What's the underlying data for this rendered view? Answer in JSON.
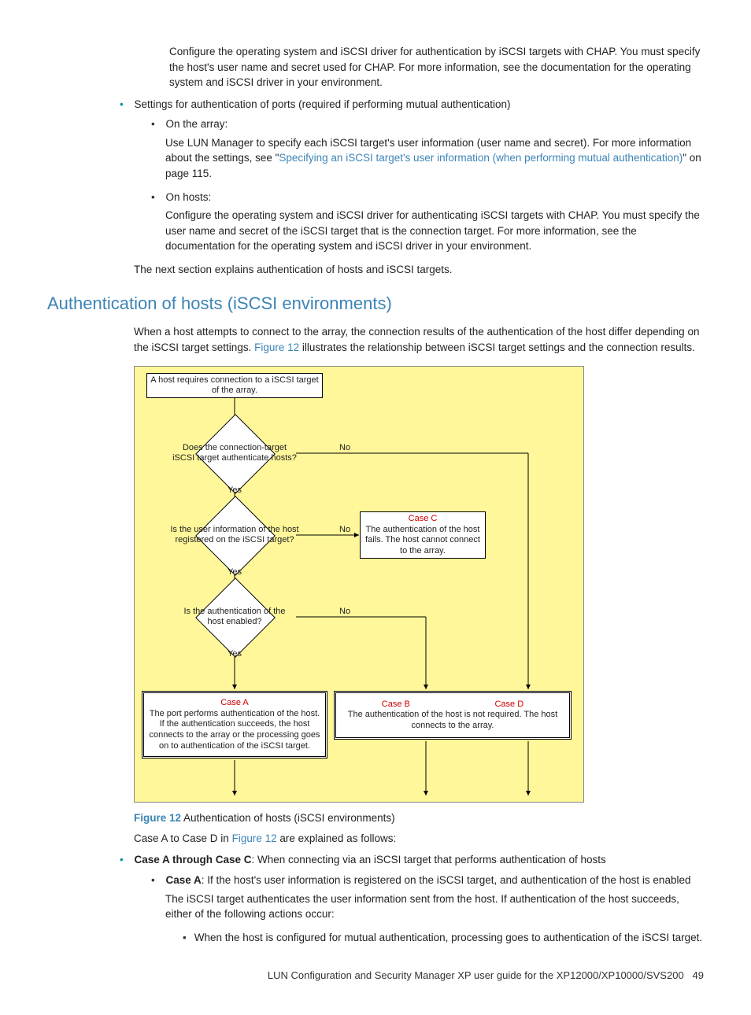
{
  "intro": {
    "para1": "Configure the operating system and iSCSI driver for authentication by iSCSI targets with CHAP. You must specify the host's user name and secret used for CHAP. For more information, see the documentation for the operating system and iSCSI driver in your environment."
  },
  "bullets": {
    "lvl1_item": "Settings for authentication of ports (required if performing mutual authentication)",
    "on_array_label": "On the array:",
    "on_array_text_prefix": "Use LUN Manager to specify each iSCSI target's user information (user name and secret). For more information about the settings, see \"",
    "on_array_link": "Specifying an iSCSI target's user information (when performing mutual authentication)",
    "on_array_text_suffix": "\" on page 115.",
    "on_hosts_label": "On hosts:",
    "on_hosts_text": "Configure the operating system and iSCSI driver for authenticating iSCSI targets with CHAP. You must specify the user name and secret of the iSCSI target that is the connection target. For more information, see the documentation for the operating system and iSCSI driver in your environment."
  },
  "next_section_line": "The next section explains authentication of hosts and iSCSI targets.",
  "heading": "Authentication of hosts (iSCSI environments)",
  "section_intro_prefix": "When a host attempts to connect to the array, the connection results of the authentication of the host differ depending on the iSCSI target settings. ",
  "section_intro_link": "Figure 12",
  "section_intro_suffix": " illustrates the relationship between iSCSI target settings and the connection results.",
  "flowchart": {
    "start": "A host requires connection to a iSCSI target of the array.",
    "d1": "Does the connection-target iSCSI target authenticate hosts?",
    "d2": "Is the user information of the host registered on the iSCSI target?",
    "d3": "Is the authentication of the host enabled?",
    "yes": "Yes",
    "no": "No",
    "caseA_title": "Case A",
    "caseA_text": "The port performs authentication of the host. If the authentication succeeds, the host connects to the array or the processing goes on to authentication of the iSCSI target.",
    "caseB_title": "Case B",
    "caseBD_text": "The authentication of the host is not required. The host connects to the array.",
    "caseC_title": "Case C",
    "caseC_text": "The authentication of the host fails. The host cannot connect to the array.",
    "caseD_title": "Case D"
  },
  "figure_caption_num": "Figure 12",
  "figure_caption_text": " Authentication of hosts (iSCSI environments)",
  "post_fig_prefix": "Case A to Case D in ",
  "post_fig_link": "Figure 12",
  "post_fig_suffix": " are explained as follows:",
  "cases": {
    "athroughc_bold": "Case A through Case C",
    "athroughc_rest": ": When connecting via an iSCSI target that performs authentication of hosts",
    "caseA_bold": "Case A",
    "caseA_rest": ": If the host's user information is registered on the iSCSI target, and authentication of the host is enabled",
    "caseA_para": "The iSCSI target authenticates the user information sent from the host. If authentication of the host succeeds, either of the following actions occur:",
    "caseA_sub1": "When the host is configured for mutual authentication, processing goes to authentication of the iSCSI target."
  },
  "footer_text": "LUN Configuration and Security Manager XP user guide for the XP12000/XP10000/SVS200",
  "footer_page": "49"
}
